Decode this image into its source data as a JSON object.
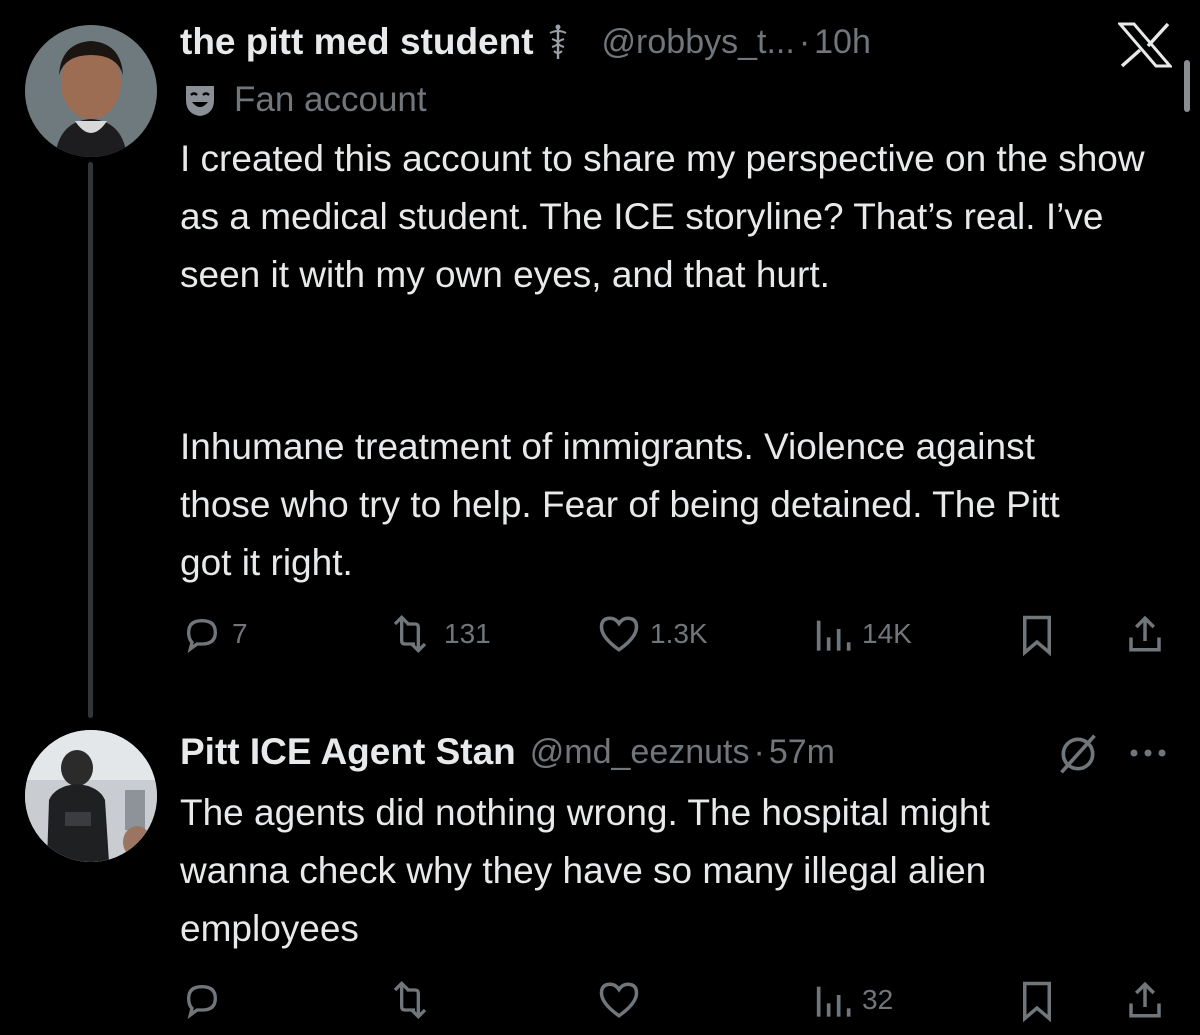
{
  "tweet1": {
    "display_name": "the pitt med student",
    "handle": "@robbys_t...",
    "separator": "·",
    "time": "10h",
    "label": "Fan account",
    "paragraph1": "I created this account to share my perspective on the show as a medical student. The ICE storyline? That’s real. I’ve seen it with my own eyes, and that hurt.",
    "paragraph2": "Inhumane treatment of immigrants. Violence against those who try to help. Fear of being detained. The Pitt got it right.",
    "replies": "7",
    "reposts": "131",
    "likes": "1.3K",
    "views": "14K"
  },
  "tweet2": {
    "display_name": "Pitt ICE Agent Stan",
    "handle": "@md_eeznuts",
    "separator": "·",
    "time": "57m",
    "text": "The agents did nothing wrong. The hospital might wanna check why they have so many illegal alien employees",
    "views": "32"
  },
  "icons": [
    "caduceus-icon",
    "x-logo-icon",
    "fan-account-icon",
    "reply-icon",
    "repost-icon",
    "like-icon",
    "views-icon",
    "bookmark-icon",
    "share-icon",
    "grok-icon",
    "more-icon"
  ],
  "colors": {
    "background": "#000000",
    "text": "#e7e9ea",
    "muted": "#71767b",
    "thread_line": "#333639"
  }
}
